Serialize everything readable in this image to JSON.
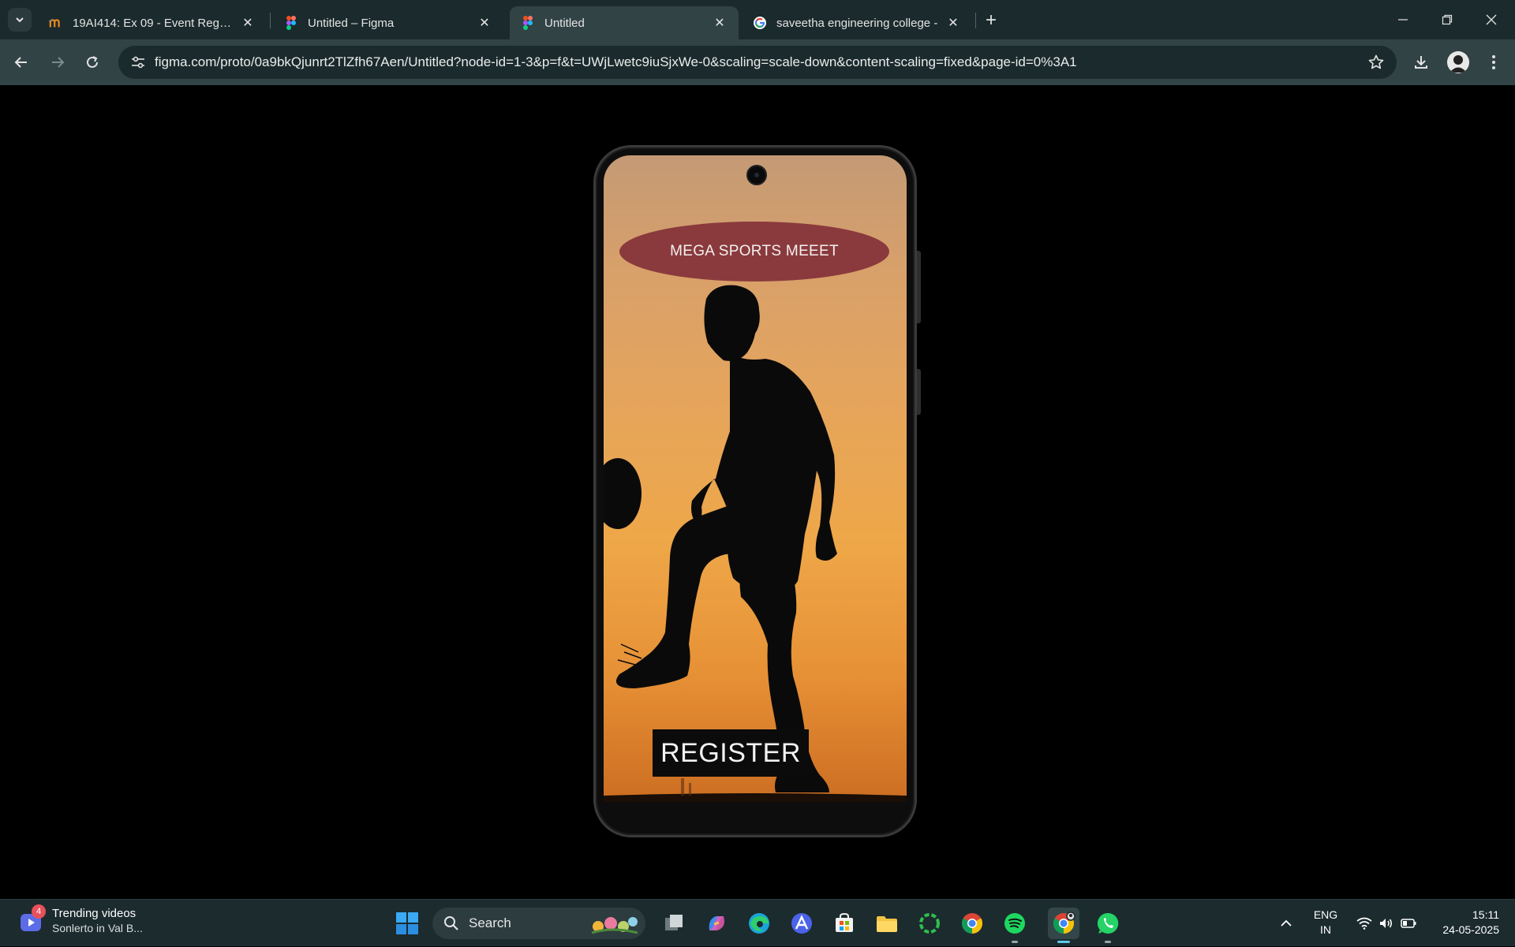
{
  "browser": {
    "tabs": [
      {
        "title": "19AI414: Ex 09 - Event Registrat",
        "favicon": "moodle-icon",
        "active": false
      },
      {
        "title": "Untitled – Figma",
        "favicon": "figma-icon",
        "active": false
      },
      {
        "title": "Untitled",
        "favicon": "figma-icon",
        "active": true
      },
      {
        "title": "saveetha engineering college -",
        "favicon": "google-icon",
        "active": false
      }
    ],
    "new_tab_label": "+",
    "url": "figma.com/proto/0a9bkQjunrt2TlZfh67Aen/Untitled?node-id=1-3&p=f&t=UWjLwetc9iuSjxWe-0&scaling=scale-down&content-scaling=fixed&page-id=0%3A1"
  },
  "prototype": {
    "header_text": "MEGA SPORTS MEEET",
    "button_label": "REGISTER",
    "colors": {
      "header_ellipse": "#8a3a3d",
      "button_bg": "#0b0b0b",
      "sky_top": "#c49a75",
      "sky_bottom": "#cc6e22"
    }
  },
  "taskbar": {
    "widget": {
      "title": "Trending videos",
      "subtitle": "Sonlerto in Val B...",
      "badge": "4"
    },
    "search_label": "Search",
    "apps": [
      "windows-start-icon",
      "file-explorer-icon",
      "copilot-icon",
      "edge-icon",
      "a-app-icon",
      "store-icon",
      "folder-icon",
      "ring-app-icon",
      "chrome-icon",
      "spotify-icon",
      "chrome-profile-icon",
      "whatsapp-icon"
    ],
    "language": {
      "line1": "ENG",
      "line2": "IN"
    },
    "time": "15:11",
    "date": "24-05-2025"
  }
}
